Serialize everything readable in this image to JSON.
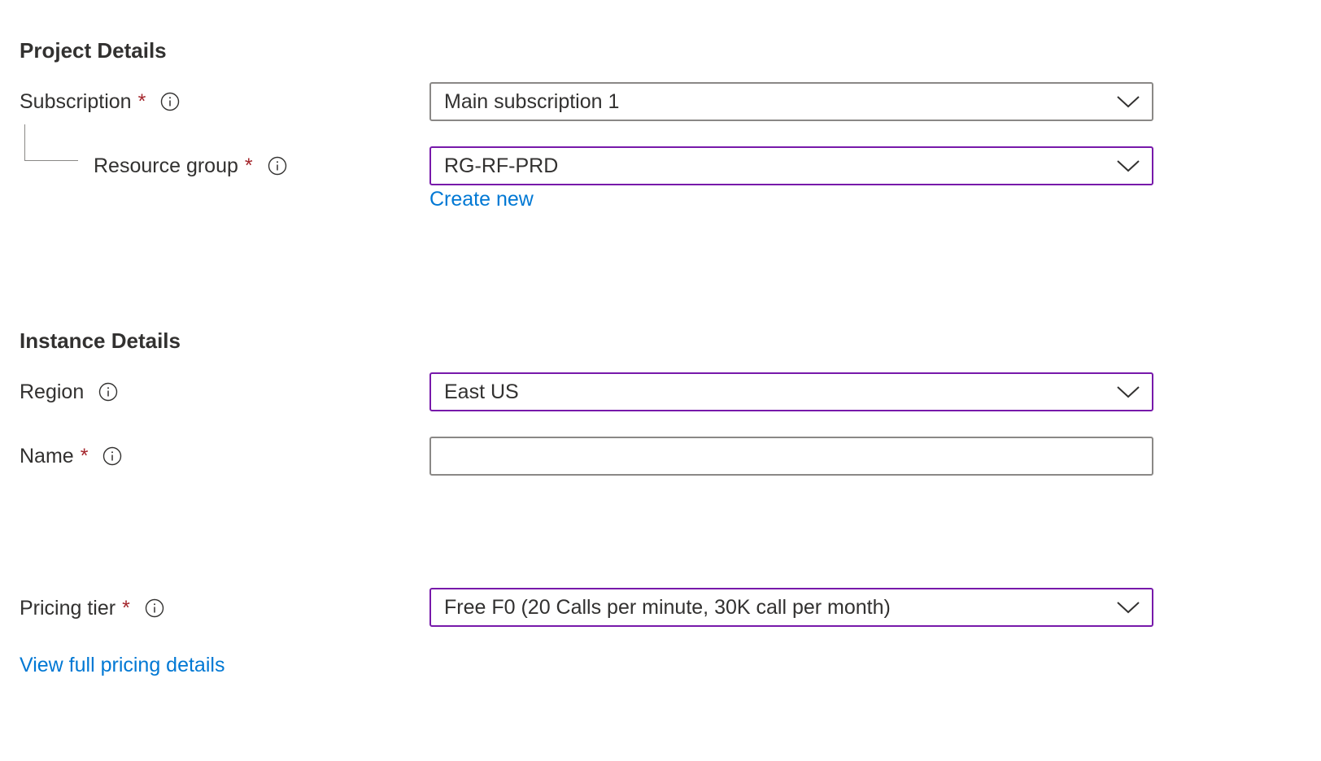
{
  "project_details": {
    "title": "Project Details",
    "subscription": {
      "label": "Subscription",
      "required_marker": "*",
      "value": "Main subscription 1"
    },
    "resource_group": {
      "label": "Resource group",
      "required_marker": "*",
      "value": "RG-RF-PRD",
      "create_new_link": "Create new"
    }
  },
  "instance_details": {
    "title": "Instance Details",
    "region": {
      "label": "Region",
      "value": "East US"
    },
    "name": {
      "label": "Name",
      "required_marker": "*",
      "value": ""
    }
  },
  "pricing": {
    "label": "Pricing tier",
    "required_marker": "*",
    "value": "Free F0 (20 Calls per minute, 30K call per month)",
    "details_link": "View full pricing details"
  },
  "icons": {
    "info": "info-circle-icon",
    "dropdown": "chevron-down-icon"
  },
  "colors": {
    "required": "#a4262c",
    "link": "#0078d4",
    "focus_border": "#7719aa",
    "default_border": "#8a8886",
    "text": "#323130"
  }
}
